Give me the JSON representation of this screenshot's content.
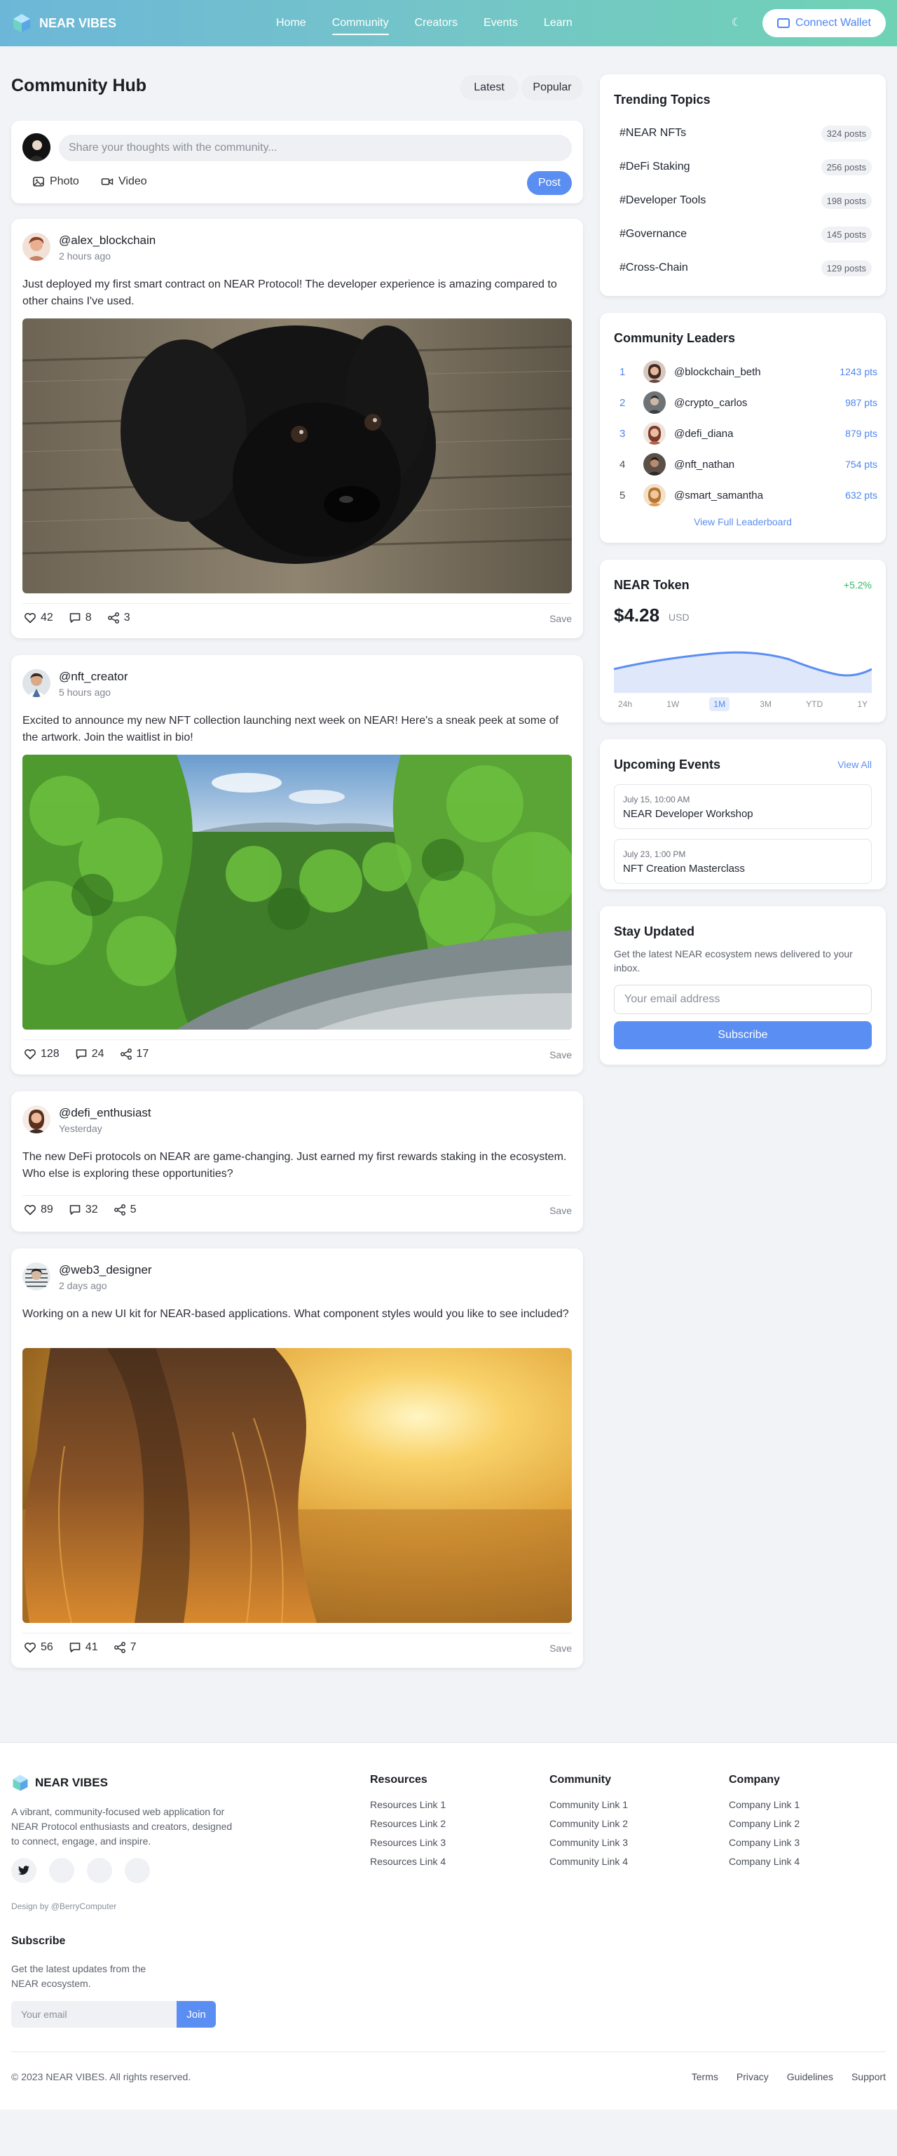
{
  "header": {
    "brand": "NEAR VIBES",
    "nav": [
      "Home",
      "Community",
      "Creators",
      "Events",
      "Learn"
    ],
    "active_nav": "Community",
    "wallet_label": "Connect Wallet"
  },
  "hub": {
    "title": "Community Hub",
    "filters": [
      "Latest",
      "Popular"
    ],
    "composer_placeholder": "Share your thoughts with the community...",
    "photo_label": "Photo",
    "video_label": "Video",
    "post_label": "Post"
  },
  "posts": [
    {
      "user": "@alex_blockchain",
      "time": "2 hours ago",
      "text": "Just deployed my first smart contract on NEAR Protocol! The developer experience is amazing compared to other chains I've used.",
      "image": "black-puppy-photo",
      "likes": "42",
      "comments": "8",
      "shares": "3",
      "save": "Save"
    },
    {
      "user": "@nft_creator",
      "time": "5 hours ago",
      "text": "Excited to announce my new NFT collection launching next week on NEAR! Here's a sneak peek at some of the artwork. Join the waitlist in bio!",
      "image": "green-forest-valley-photo",
      "likes": "128",
      "comments": "24",
      "shares": "17",
      "save": "Save"
    },
    {
      "user": "@defi_enthusiast",
      "time": "Yesterday",
      "text": "The new DeFi protocols on NEAR are game-changing. Just earned my first rewards staking in the ecosystem. Who else is exploring these opportunities?",
      "likes": "89",
      "comments": "32",
      "shares": "5",
      "save": "Save"
    },
    {
      "user": "@web3_designer",
      "time": "2 days ago",
      "text": "Working on a new UI kit for NEAR-based applications. What component styles would you like to see included?",
      "image": "sunset-hair-photo",
      "likes": "56",
      "comments": "41",
      "shares": "7",
      "save": "Save"
    }
  ],
  "trending": {
    "title": "Trending Topics",
    "items": [
      {
        "name": "#NEAR NFTs",
        "count": "324 posts"
      },
      {
        "name": "#DeFi Staking",
        "count": "256 posts"
      },
      {
        "name": "#Developer Tools",
        "count": "198 posts"
      },
      {
        "name": "#Governance",
        "count": "145 posts"
      },
      {
        "name": "#Cross-Chain",
        "count": "129 posts"
      }
    ]
  },
  "leaders": {
    "title": "Community Leaders",
    "items": [
      {
        "rank": "1",
        "name": "@blockchain_beth",
        "pts": "1243 pts"
      },
      {
        "rank": "2",
        "name": "@crypto_carlos",
        "pts": "987 pts"
      },
      {
        "rank": "3",
        "name": "@defi_diana",
        "pts": "879 pts"
      },
      {
        "rank": "4",
        "name": "@nft_nathan",
        "pts": "754 pts"
      },
      {
        "rank": "5",
        "name": "@smart_samantha",
        "pts": "632 pts"
      }
    ],
    "link": "View Full Leaderboard"
  },
  "token": {
    "title": "NEAR Token",
    "change": "+5.2%",
    "price": "$4.28",
    "unit": "USD",
    "ranges": [
      "24h",
      "1W",
      "1M",
      "3M",
      "YTD",
      "1Y"
    ],
    "active_range": "1M"
  },
  "events": {
    "title": "Upcoming Events",
    "view_all": "View All",
    "items": [
      {
        "date": "July 15, 10:00 AM",
        "name": "NEAR Developer Workshop"
      },
      {
        "date": "July 23, 1:00 PM",
        "name": "NFT Creation Masterclass"
      }
    ]
  },
  "newsletter": {
    "title": "Stay Updated",
    "desc": "Get the latest NEAR ecosystem news delivered to your inbox.",
    "placeholder": "Your email address",
    "button": "Subscribe"
  },
  "footer": {
    "brand": "NEAR VIBES",
    "desc": "A vibrant, community-focused web application for NEAR Protocol enthusiasts and creators, designed to connect, engage, and inspire.",
    "credit": "Design by @BerryComputer",
    "subscribe_title": "Subscribe",
    "subscribe_desc": "Get the latest updates from the NEAR ecosystem.",
    "subscribe_placeholder": "Your email",
    "subscribe_button": "Join",
    "columns": [
      {
        "title": "Resources",
        "links": [
          "Resources Link 1",
          "Resources Link 2",
          "Resources Link 3",
          "Resources Link 4"
        ]
      },
      {
        "title": "Community",
        "links": [
          "Community Link 1",
          "Community Link 2",
          "Community Link 3",
          "Community Link 4"
        ]
      },
      {
        "title": "Company",
        "links": [
          "Company Link 1",
          "Company Link 2",
          "Company Link 3",
          "Company Link 4"
        ]
      }
    ],
    "copyright": "© 2023 NEAR VIBES. All rights reserved.",
    "legal": [
      "Terms",
      "Privacy",
      "Guidelines",
      "Support"
    ]
  },
  "colors": {
    "accent": "#5b8ef2",
    "header_gradient_start": "#6cb7d8",
    "header_gradient_end": "#6fd2b5",
    "positive": "#2cb95f"
  }
}
